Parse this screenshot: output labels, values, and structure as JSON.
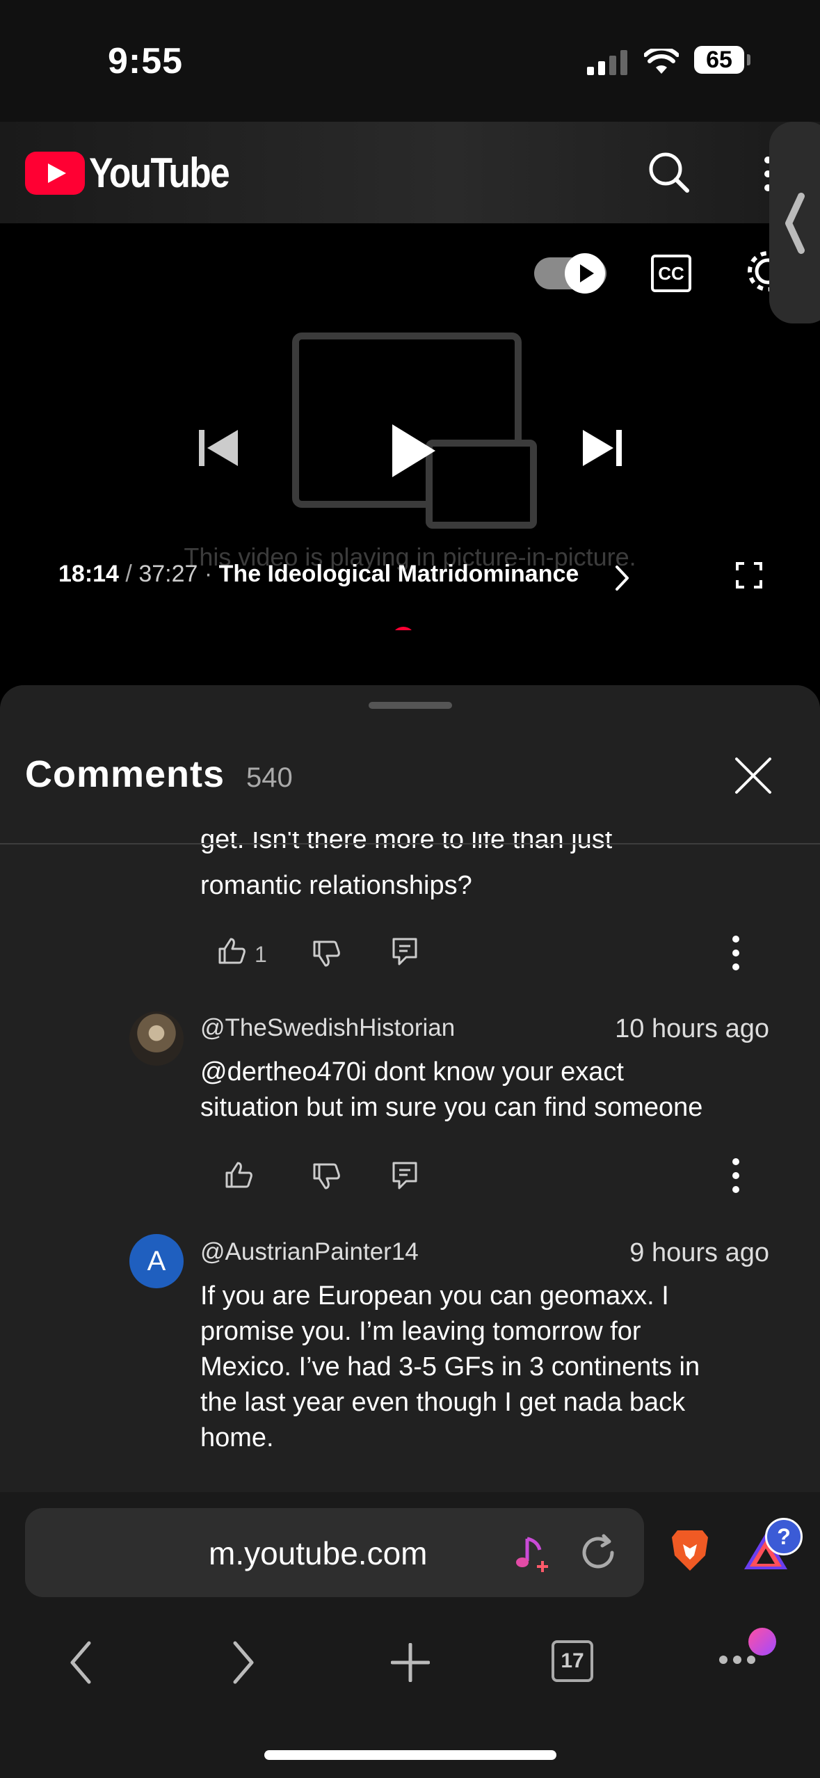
{
  "status_bar": {
    "time": "9:55",
    "battery": "65"
  },
  "youtube": {
    "logo_text": "YouTube"
  },
  "player": {
    "pip_message": "This video is playing in picture-in-picture.",
    "current_time": "18:14",
    "separator": "/",
    "duration": "37:27",
    "dot": "·",
    "chapter_title": "The Ideological Matridominance",
    "cc_label": "CC",
    "progress": 0.49,
    "accent_color": "#ff0033"
  },
  "comments": {
    "title": "Comments",
    "count": "540",
    "items": [
      {
        "text_line1": "get. Isn't there more to life than just",
        "text_line2": "romantic relationships?",
        "likes": "1"
      },
      {
        "handle": "@TheSwedishHistorian",
        "time_ago": "10 hours ago",
        "text_line1": "@dertheo470i dont know your exact",
        "text_line2": "situation but im sure you can find someone"
      },
      {
        "handle": "@AustrianPainter14",
        "time_ago": "9 hours ago",
        "avatar_letter": "A",
        "text_line1": "If you are European you can geomaxx. I",
        "text_line2": "promise you. I’m leaving tomorrow for",
        "text_line3": "Mexico. I’ve had 3-5 GFs in 3 continents in",
        "text_line4": "the last year even though I get nada back",
        "text_line5": "home."
      }
    ]
  },
  "browser": {
    "url": "m.youtube.com",
    "tab_count": "17",
    "help_badge": "?"
  }
}
